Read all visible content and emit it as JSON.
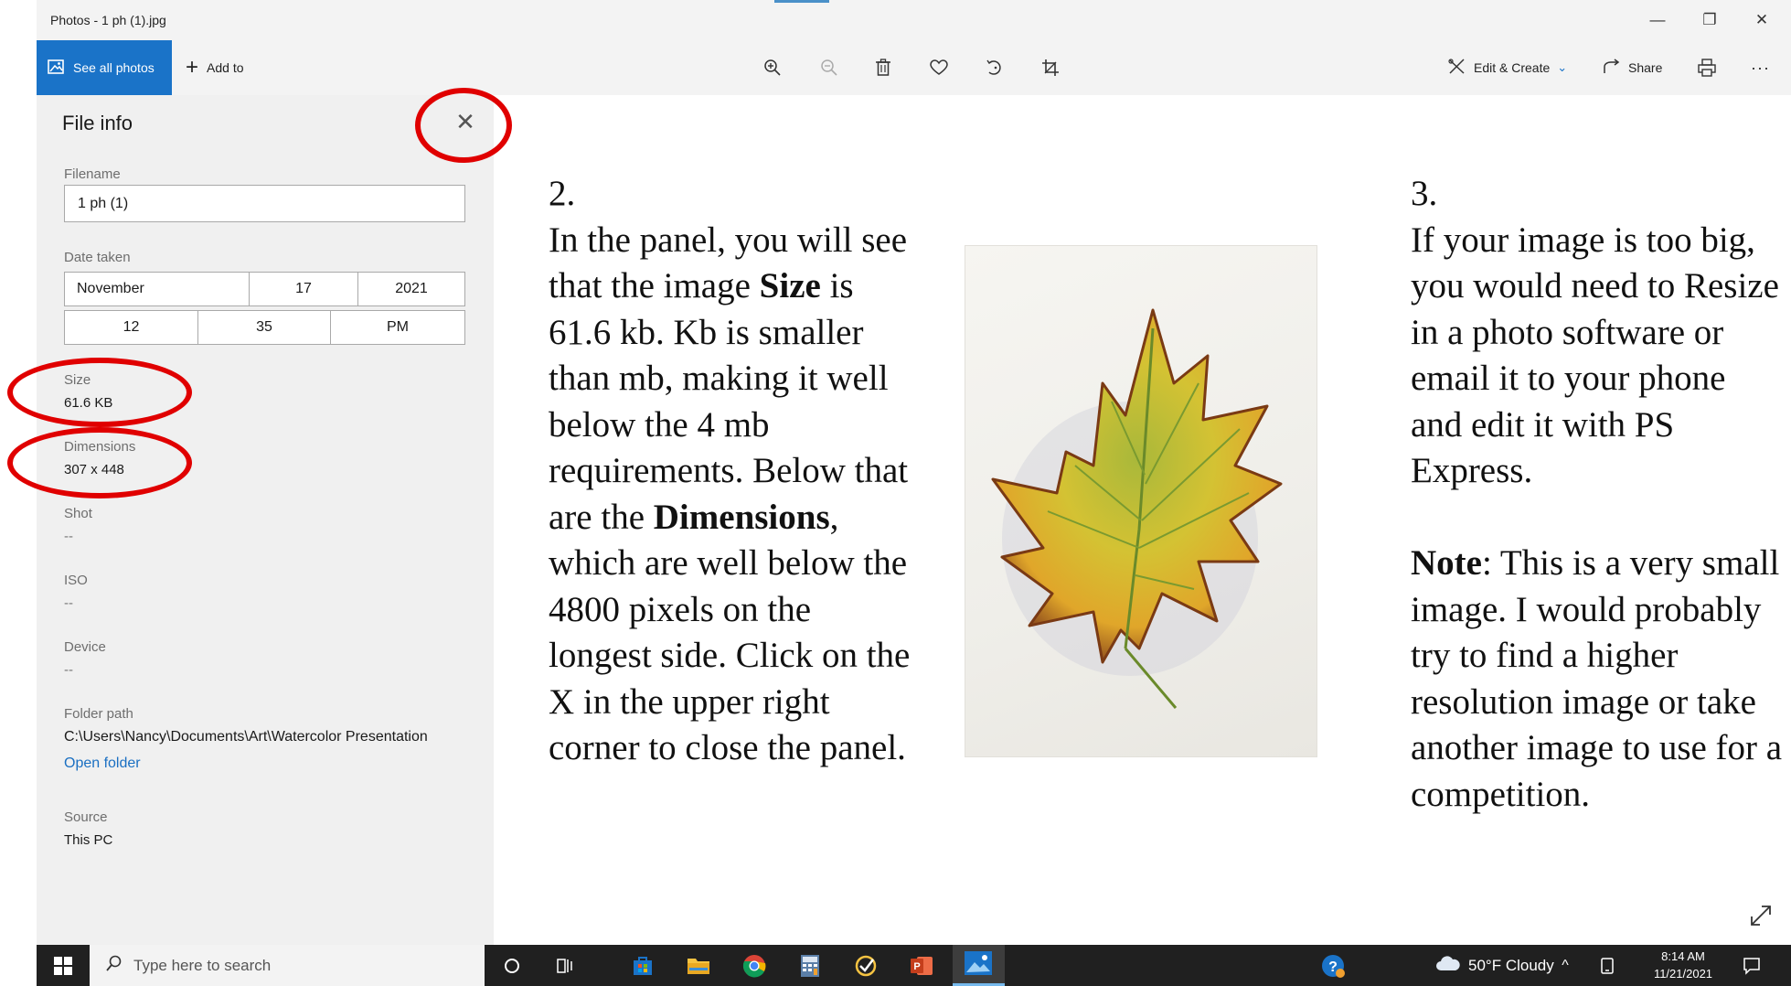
{
  "window": {
    "title": "Photos - 1 ph (1).jpg",
    "minimize": "—",
    "restore": "❐",
    "close": "✕"
  },
  "toolbar": {
    "see_all_photos": "See all photos",
    "add_to": "Add to",
    "edit_create": "Edit & Create",
    "share": "Share",
    "more": "···"
  },
  "panel": {
    "title": "File info",
    "filename_label": "Filename",
    "filename_value": "1 ph (1)",
    "date_label": "Date taken",
    "month": "November",
    "day": "17",
    "year": "2021",
    "hour": "12",
    "minute": "35",
    "ampm": "PM",
    "size_label": "Size",
    "size_value": "61.6 KB",
    "dimensions_label": "Dimensions",
    "dimensions_value": "307 x 448",
    "shot_label": "Shot",
    "shot_value": "--",
    "iso_label": "ISO",
    "iso_value": "--",
    "device_label": "Device",
    "device_value": "--",
    "folder_label": "Folder path",
    "folder_value": "C:\\Users\\Nancy\\Documents\\Art\\Watercolor Presentation",
    "open_folder": "Open folder",
    "source_label": "Source",
    "source_value": "This PC"
  },
  "instructions": {
    "step2_num": "2.",
    "step2_a": "In the panel, you will see that the image ",
    "step2_size": "Size",
    "step2_b": " is 61.6 kb. Kb is smaller than mb, making it well below the 4 mb requirements.  Below that are the ",
    "step2_dimensions": "Dimensions",
    "step2_c": ", which are well below the 4800 pixels on the longest side. Click on the X in the upper right corner to close the panel.",
    "step3_num": "3.",
    "step3_text": "If your image is too big, you would need to Resize in a photo software or email it to your phone and edit it with PS Express.",
    "note_bold": "Note",
    "note_text": ":  This is a very small image.  I would probably try to find a higher resolution image or take another image to use for a competition."
  },
  "taskbar": {
    "search_placeholder": "Type here to search",
    "weather": "50°F  Cloudy",
    "time": "8:14 AM",
    "date": "11/21/2021"
  },
  "colors": {
    "accent": "#1a73c8",
    "annotation": "#e00000",
    "panel_bg": "#f0f0f0",
    "taskbar": "#202020"
  }
}
